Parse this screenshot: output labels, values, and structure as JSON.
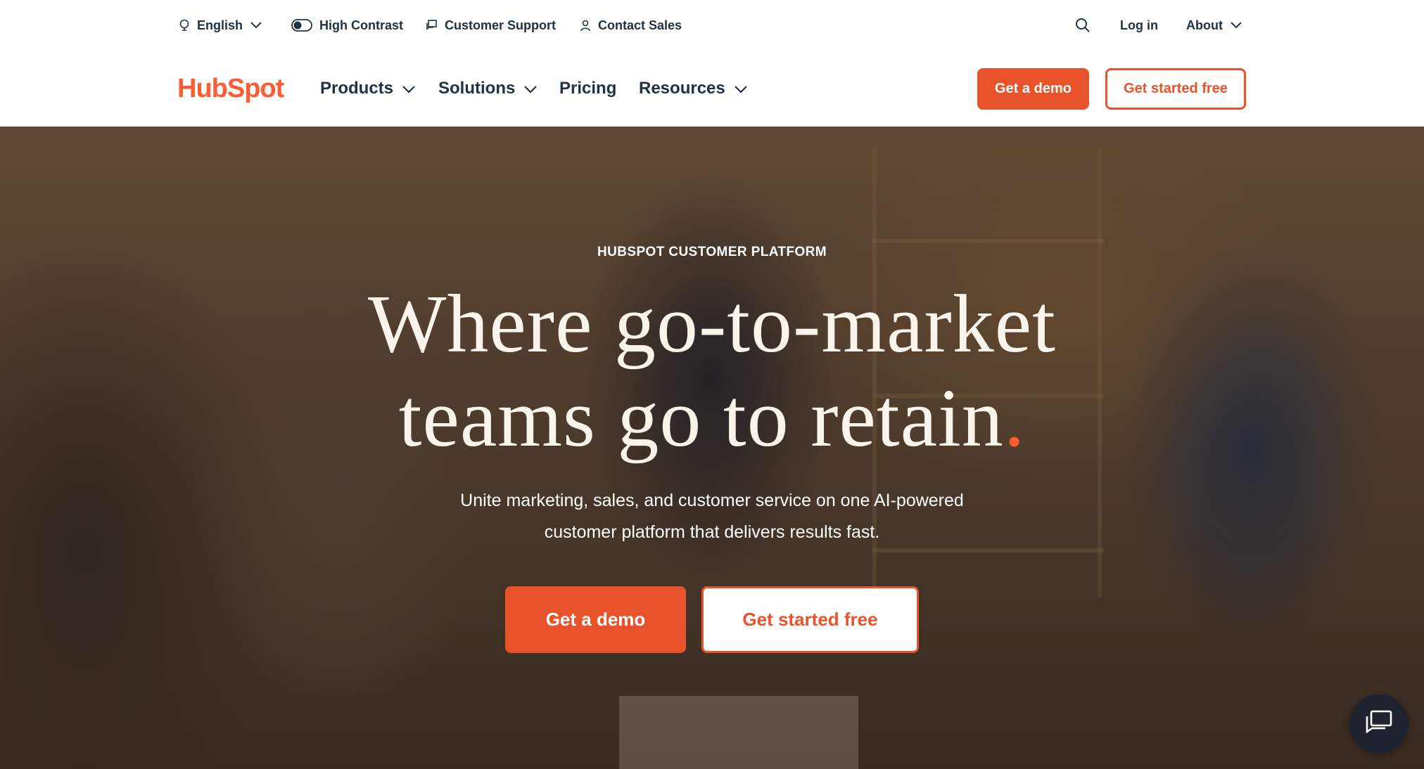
{
  "utility_bar": {
    "language": "English",
    "high_contrast": "High Contrast",
    "customer_support": "Customer Support",
    "contact_sales": "Contact Sales",
    "login": "Log in",
    "about": "About"
  },
  "nav": {
    "logo_text": "HubSpot",
    "items": {
      "products": "Products",
      "solutions": "Solutions",
      "pricing": "Pricing",
      "resources": "Resources"
    },
    "demo_button": "Get a demo",
    "started_button": "Get started free"
  },
  "hero": {
    "eyebrow": "HUBSPOT CUSTOMER PLATFORM",
    "title_line1": "Where go-to-market",
    "title_line2": "teams go to retain",
    "title_dot": ".",
    "subtitle_line1": "Unite marketing, sales, and customer service on one AI-powered",
    "subtitle_line2": "customer platform that delivers results fast.",
    "demo_button": "Get a demo",
    "started_button": "Get started free"
  },
  "colors": {
    "brand_orange": "#ff5c35",
    "button_orange": "#e8532c",
    "text_dark": "#213343"
  },
  "icons": {
    "language": "globe-icon",
    "contrast": "toggle-icon",
    "support": "chat-icon",
    "sales": "person-icon",
    "search": "search-icon",
    "chat_widget": "chat-bubble-icon"
  }
}
